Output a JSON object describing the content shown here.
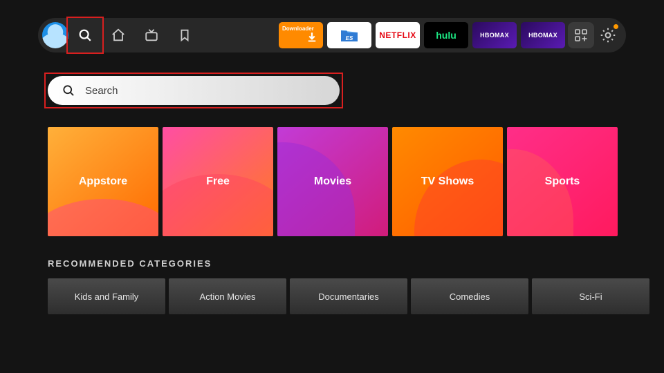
{
  "nav": {
    "apps": [
      {
        "name": "downloader",
        "label": "Downloader"
      },
      {
        "name": "es-file-explorer",
        "label": "ES"
      },
      {
        "name": "netflix",
        "label": "NETFLIX"
      },
      {
        "name": "hulu",
        "label": "hulu"
      },
      {
        "name": "hbomax-1",
        "label": "HBOMAX"
      },
      {
        "name": "hbomax-2",
        "label": "HBOMAX"
      }
    ],
    "settings_notification": true
  },
  "search": {
    "placeholder": "Search"
  },
  "tiles": [
    {
      "label": "Appstore",
      "name": "appstore"
    },
    {
      "label": "Free",
      "name": "free"
    },
    {
      "label": "Movies",
      "name": "movies"
    },
    {
      "label": "TV Shows",
      "name": "tvshows"
    },
    {
      "label": "Sports",
      "name": "sports"
    }
  ],
  "recommended": {
    "title": "RECOMMENDED CATEGORIES",
    "items": [
      "Kids and Family",
      "Action Movies",
      "Documentaries",
      "Comedies",
      "Sci-Fi"
    ]
  }
}
